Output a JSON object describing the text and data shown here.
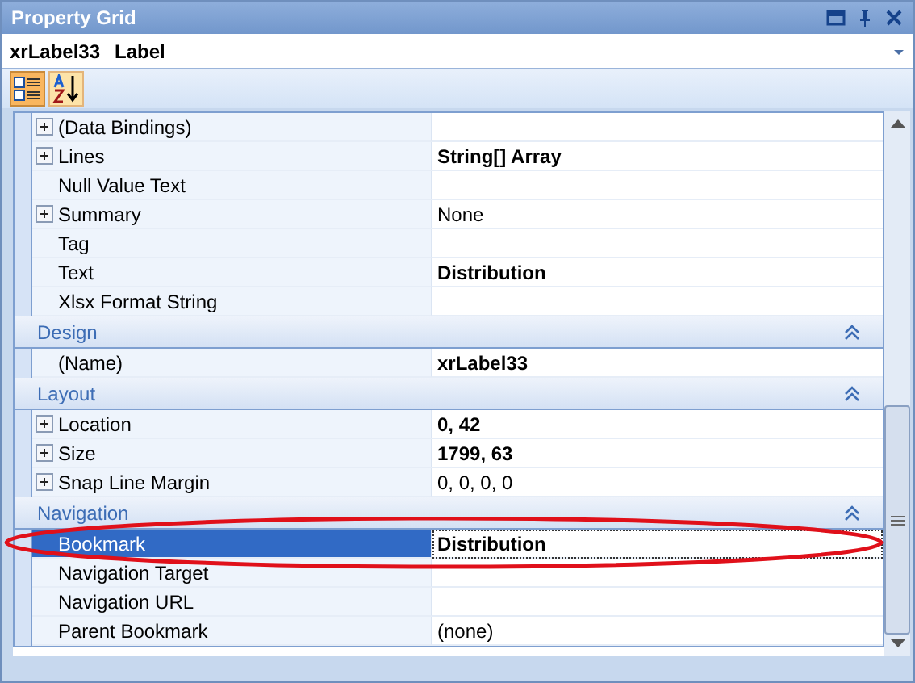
{
  "window": {
    "title": "Property Grid"
  },
  "object_selector": {
    "name": "xrLabel33",
    "type": "Label"
  },
  "toolbar": [
    {
      "kind": "categorized",
      "selected": true
    },
    {
      "kind": "alphabetical",
      "selected": false
    }
  ],
  "groups": [
    {
      "rows": [
        {
          "name": "(Data Bindings)",
          "expandable": true,
          "selected": false
        },
        {
          "name": "Lines",
          "value": "String[] Array",
          "expandable": true,
          "bold": true,
          "selected": false
        },
        {
          "name": "Null Value Text",
          "expandable": false,
          "selected": false
        },
        {
          "name": "Summary",
          "value": "None",
          "expandable": true,
          "bold": false,
          "selected": false
        },
        {
          "name": "Tag",
          "expandable": false,
          "selected": false
        },
        {
          "name": "Text",
          "value": "Distribution",
          "expandable": false,
          "bold": true,
          "selected": false
        },
        {
          "name": "Xlsx Format String",
          "expandable": false,
          "selected": false
        }
      ]
    },
    {
      "title": "Design",
      "expanded": true,
      "rows": [
        {
          "name": "(Name)",
          "value": "xrLabel33",
          "expandable": false,
          "bold": true,
          "selected": false
        }
      ]
    },
    {
      "title": "Layout",
      "expanded": true,
      "rows": [
        {
          "name": "Location",
          "value": "0, 42",
          "expandable": true,
          "bold": true,
          "selected": false
        },
        {
          "name": "Size",
          "value": "1799, 63",
          "expandable": true,
          "bold": true,
          "selected": false
        },
        {
          "name": "Snap Line Margin",
          "value": "0, 0, 0, 0",
          "expandable": true,
          "bold": false,
          "selected": false
        }
      ]
    },
    {
      "title": "Navigation",
      "expanded": true,
      "rows": [
        {
          "name": "Bookmark",
          "value": "Distribution",
          "expandable": false,
          "bold": true,
          "selected": true
        },
        {
          "name": "Navigation Target",
          "expandable": false,
          "selected": false
        },
        {
          "name": "Navigation URL",
          "expandable": false,
          "selected": false
        },
        {
          "name": "Parent Bookmark",
          "value": "(none)",
          "expandable": false,
          "bold": false,
          "selected": false
        }
      ]
    }
  ]
}
